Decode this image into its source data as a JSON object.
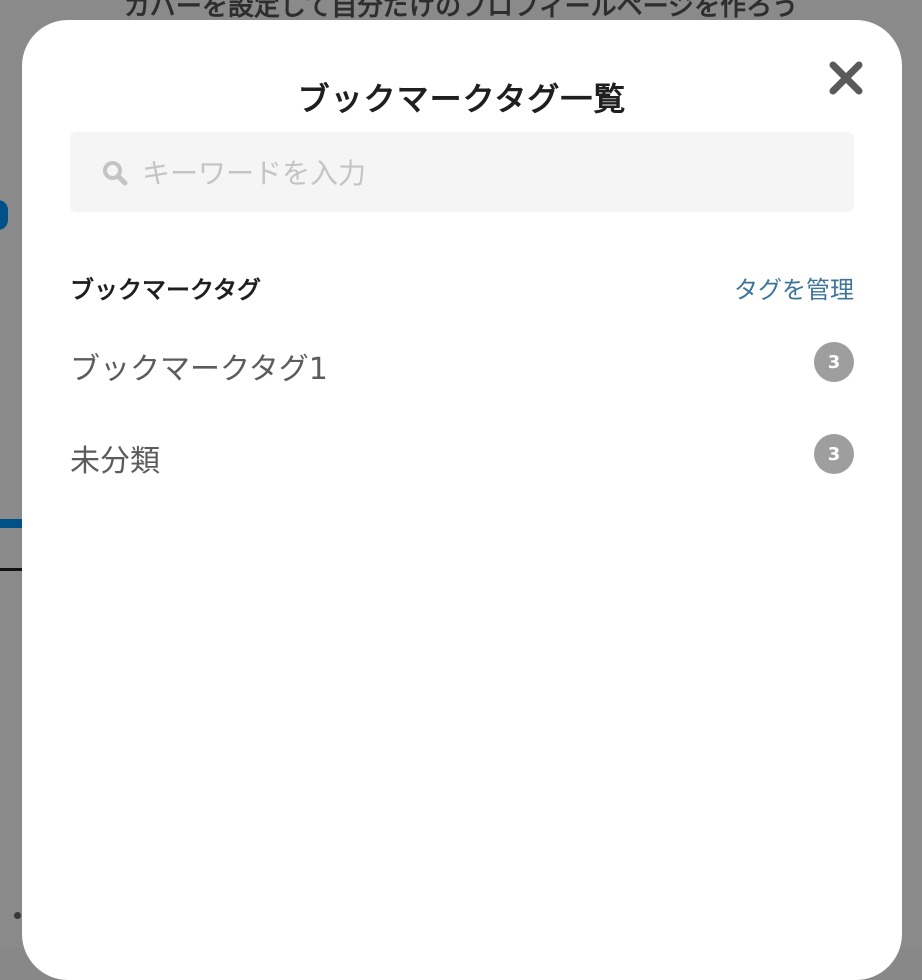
{
  "background": {
    "banner_text": "カバーを設定して自分だけのプロフィールページを作ろう"
  },
  "modal": {
    "title": "ブックマークタグ一覧",
    "close_icon": "close-icon"
  },
  "search": {
    "placeholder": "キーワードを入力",
    "value": "",
    "icon": "search-icon"
  },
  "section": {
    "title": "ブックマークタグ",
    "manage_label": "タグを管理"
  },
  "tags": [
    {
      "label": "ブックマークタグ1",
      "count": "3"
    },
    {
      "label": "未分類",
      "count": "3"
    }
  ],
  "colors": {
    "link": "#3d7699",
    "badge": "#9e9e9e",
    "accent": "#0096fa"
  }
}
